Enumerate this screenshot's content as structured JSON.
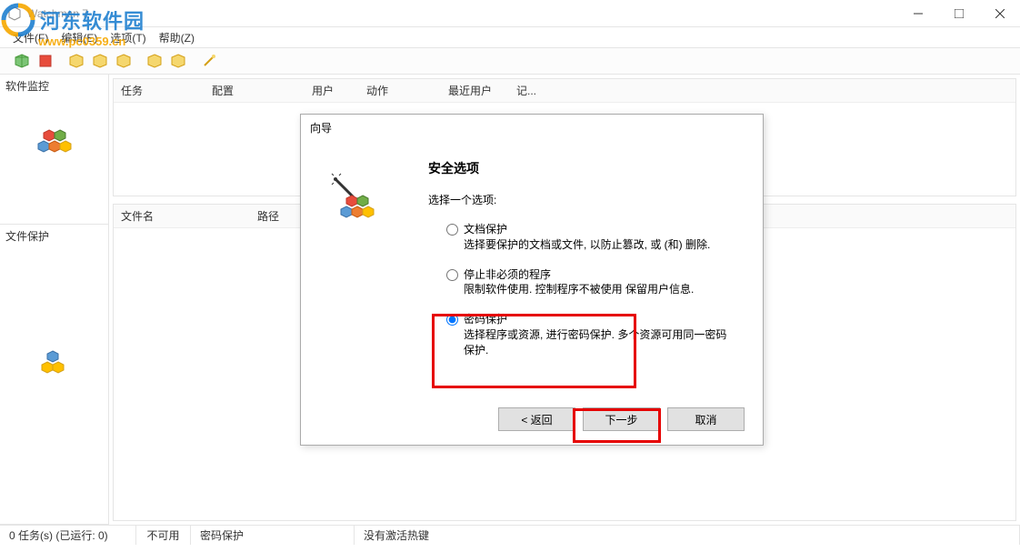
{
  "app": {
    "title": "Watchman 7"
  },
  "menubar": {
    "file": "文件(F)",
    "edit": "编辑(E)",
    "options": "选项(T)",
    "help": "帮助(Z)"
  },
  "sidebar": {
    "monitor": "软件监控",
    "protect": "文件保护"
  },
  "panel_top": {
    "cols": [
      "任务",
      "配置",
      "用户",
      "动作",
      "最近用户",
      "记..."
    ]
  },
  "panel_bottom": {
    "cols": [
      "文件名",
      "路径"
    ]
  },
  "status": {
    "tasks": "0 任务(s) (已运行: 0)",
    "na": "不可用",
    "pw": "密码保护",
    "hotkey": "没有激活热键"
  },
  "dialog": {
    "title": "向导",
    "heading": "安全选项",
    "subtitle": "选择一个选项:",
    "options": [
      {
        "title": "文档保护",
        "desc": "选择要保护的文档或文件, 以防止篡改, 或 (和) 删除."
      },
      {
        "title": "停止非必须的程序",
        "desc": "限制软件使用. 控制程序不被使用 保留用户信息."
      },
      {
        "title": "密码保护",
        "desc": "选择程序或资源, 进行密码保护. 多个资源可用同一密码保护."
      }
    ],
    "btn_back": "< 返回",
    "btn_next": "下一步",
    "btn_cancel": "取消"
  },
  "watermark": {
    "text": "河东软件园",
    "url": "www.pc0359.cn"
  }
}
